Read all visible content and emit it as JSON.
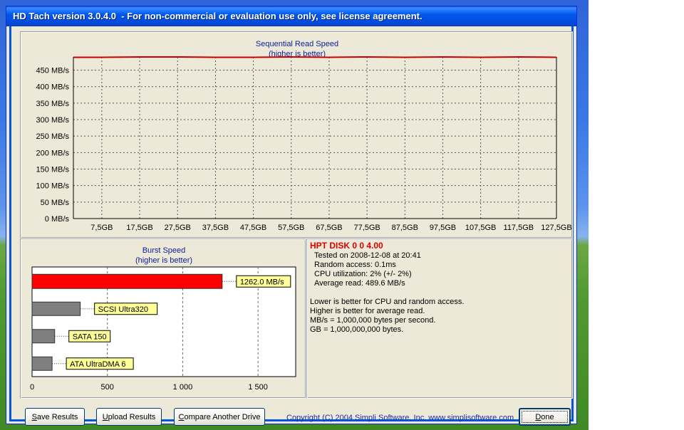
{
  "window": {
    "title": "HD Tach version 3.0.4.0  - For non-commercial or evaluation use only, see license agreement."
  },
  "colors": {
    "title_text": "#0a1e9a",
    "read_line": "#cc0000",
    "burst_bar_current": "#ff0000",
    "burst_bar_reference": "#7f7f7f",
    "label_box": "#ffff99",
    "drive_name": "#dd0000"
  },
  "sequential": {
    "title_line1": "Sequential Read Speed",
    "title_line2": "(higher is better)"
  },
  "burst": {
    "title_line1": "Burst Speed",
    "title_line2": "(higher is better)"
  },
  "info": {
    "drive_name": "HPT DISK 0 0 4.00",
    "tested_on": "Tested on 2008-12-08 at 20:41",
    "random_access": "Random access: 0.1ms",
    "cpu_utilization": "CPU utilization: 2% (+/- 2%)",
    "average_read": "Average read: 489.6 MB/s",
    "note1": "Lower is better for CPU and random access.",
    "note2": "Higher is better for average read.",
    "note3": "MB/s = 1,000,000 bytes per second.",
    "note4": "GB = 1,000,000,000 bytes."
  },
  "buttons": {
    "save_prefix": "S",
    "save_rest": "ave Results",
    "upload_prefix": "U",
    "upload_rest": "pload Results",
    "compare_prefix": "C",
    "compare_rest": "ompare Another Drive",
    "done_prefix": "D",
    "done_rest": "one"
  },
  "copyright": "Copyright (C) 2004 Simpli Software, Inc. www.simplisoftware.com",
  "chart_data": [
    {
      "type": "line",
      "title": "Sequential Read Speed",
      "subtitle": "(higher is better)",
      "y_ticks": [
        "0 MB/s",
        "50 MB/s",
        "100 MB/s",
        "150 MB/s",
        "200 MB/s",
        "250 MB/s",
        "300 MB/s",
        "350 MB/s",
        "400 MB/s",
        "450 MB/s"
      ],
      "x_ticks": [
        "7,5GB",
        "17,5GB",
        "27,5GB",
        "37,5GB",
        "47,5GB",
        "57,5GB",
        "67,5GB",
        "77,5GB",
        "87,5GB",
        "97,5GB",
        "107,5GB",
        "117,5GB",
        "127,5GB"
      ],
      "x_tick_values": [
        7.5,
        17.5,
        27.5,
        37.5,
        47.5,
        57.5,
        67.5,
        77.5,
        87.5,
        97.5,
        107.5,
        117.5,
        127.5
      ],
      "xlim": [
        0,
        127.5
      ],
      "ylim": [
        0,
        490
      ],
      "grid": true,
      "series": [
        {
          "x": [
            0,
            7.5,
            17.5,
            27.5,
            37.5,
            47.5,
            57.5,
            67.5,
            77.5,
            87.5,
            97.5,
            107.5,
            117.5,
            127.5
          ],
          "values": [
            489,
            489,
            490,
            490,
            489,
            489,
            490,
            489,
            490,
            489,
            490,
            489,
            490,
            489
          ]
        }
      ]
    },
    {
      "type": "bar",
      "orientation": "horizontal",
      "title": "Burst Speed",
      "subtitle": "(higher is better)",
      "categories": [
        "1262.0 MB/s",
        "SCSI Ultra320",
        "SATA 150",
        "ATA UltraDMA 6"
      ],
      "values": [
        1262.0,
        320,
        150,
        133
      ],
      "x_ticks": [
        "0",
        "500",
        "1 000",
        "1 500"
      ],
      "x_tick_values": [
        0,
        500,
        1000,
        1500
      ],
      "xlim": [
        0,
        1750
      ],
      "grid": true
    }
  ]
}
